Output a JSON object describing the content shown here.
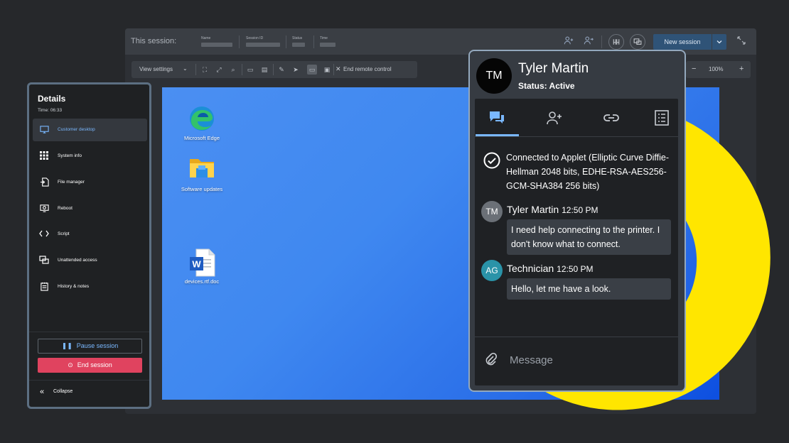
{
  "top_bar": {
    "session_label": "This session:",
    "columns": [
      "Name",
      "Session ID",
      "Status",
      "Time"
    ],
    "new_session_label": "New session"
  },
  "toolbar": {
    "view_settings": "View settings",
    "end_remote_control": "End remote control",
    "zoom_value": "100%"
  },
  "desktop": {
    "icons": [
      {
        "label": "Microsoft Edge",
        "icon": "edge-icon"
      },
      {
        "label": "Software updates",
        "icon": "folder-icon"
      },
      {
        "label": "devices.rtf.doc",
        "icon": "word-doc-icon"
      }
    ]
  },
  "details": {
    "title": "Details",
    "time": "Time: 06:33",
    "nav": [
      {
        "label": "Customer desktop",
        "icon": "desktop-icon",
        "active": true
      },
      {
        "label": "System info",
        "icon": "grid-icon"
      },
      {
        "label": "File manager",
        "icon": "file-transfer-icon"
      },
      {
        "label": "Reboot",
        "icon": "reboot-icon"
      },
      {
        "label": "Script",
        "icon": "code-icon"
      },
      {
        "label": "Unattended access",
        "icon": "monitors-icon"
      },
      {
        "label": "History & notes",
        "icon": "notes-icon"
      }
    ],
    "pause_label": "Pause session",
    "end_label": "End session",
    "collapse_label": "Collapse"
  },
  "chat": {
    "initials": "TM",
    "name": "Tyler Martin",
    "status": "Status: Active",
    "system_message": "Connected to Applet (Elliptic Curve Diffie-Hellman 2048 bits, EDHE-RSA-AES256-GCM-SHA384 256 bits)",
    "messages": [
      {
        "initials": "TM",
        "author": "Tyler Martin",
        "time": "12:50 PM",
        "text": "I need help connecting to the printer. I don't know what to connect.",
        "avatar_color": "#6b7077"
      },
      {
        "initials": "AG",
        "author": "Technician",
        "time": "12:50 PM",
        "text": "Hello, let me have a look.",
        "avatar_color": "#2a93a8"
      }
    ],
    "input_placeholder": "Message"
  },
  "colors": {
    "accent": "#7ab8ff",
    "danger": "#e0435f",
    "highlight": "#ffe600"
  }
}
